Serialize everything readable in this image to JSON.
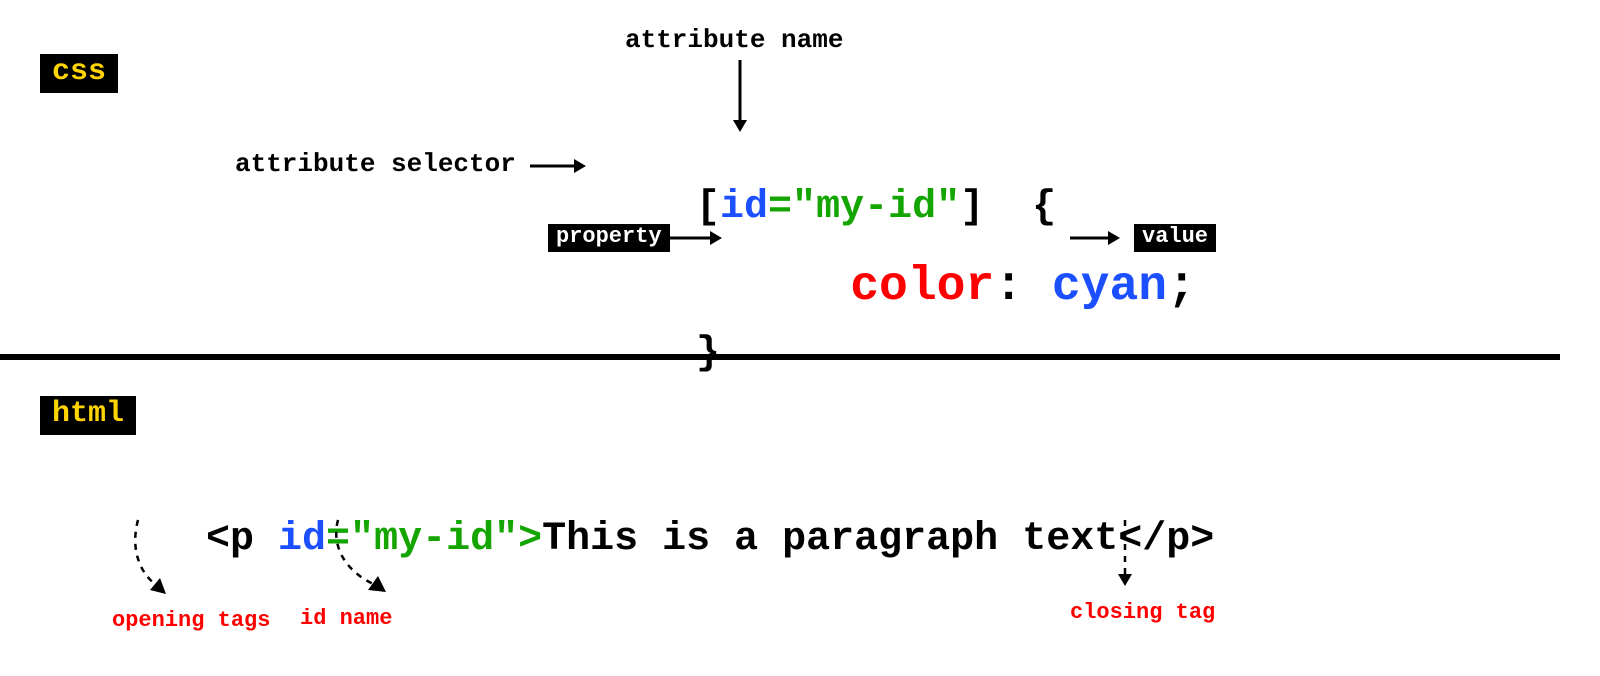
{
  "badges": {
    "css": "css",
    "html": "html"
  },
  "labels": {
    "attribute_name": "attribute name",
    "attribute_selector": "attribute selector",
    "property": "property",
    "value": "value",
    "opening_tags": "opening tags",
    "id_name": "id name",
    "closing_tag": "closing tag"
  },
  "css_code": {
    "bracket_open": "[",
    "attr_name": "id",
    "equals_quote_open": "=\"",
    "attr_value": "my-id",
    "quote_close": "\"",
    "bracket_close": "]",
    "brace_open": "{",
    "property_name": "color",
    "colon_space": ": ",
    "property_value": "cyan",
    "semicolon": ";",
    "brace_close": "}"
  },
  "html_code": {
    "open_tag_start": "<p ",
    "attr_name": "id",
    "equals_quote_open": "=\"",
    "attr_value": "my-id",
    "quote_close_tag_close": "\">",
    "text_content": "This is a paragraph text",
    "close_tag": "</p>"
  }
}
